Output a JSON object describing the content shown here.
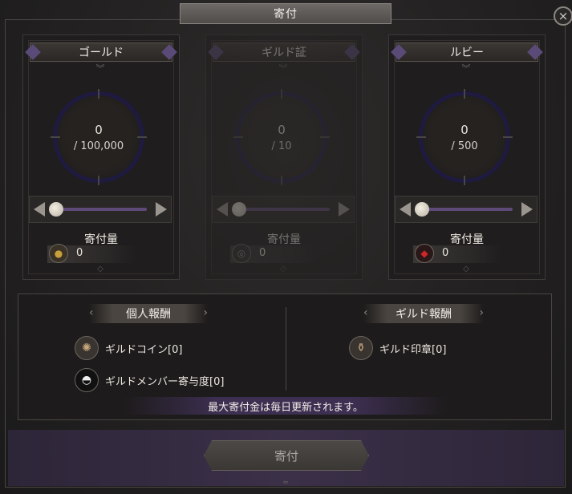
{
  "window": {
    "title": "寄付",
    "close_icon": "×"
  },
  "panels": [
    {
      "name": "ゴールド",
      "current": "0",
      "max": "/ 100,000",
      "amount_label": "寄付量",
      "amount": "0",
      "icon": "gold-coin-icon",
      "icon_glyph": "●",
      "icon_color": "#c9a13a",
      "enabled": true
    },
    {
      "name": "ギルド証",
      "current": "0",
      "max": "/ 10",
      "amount_label": "寄付量",
      "amount": "0",
      "icon": "guild-token-icon",
      "icon_glyph": "◎",
      "icon_color": "#9a958f",
      "enabled": false
    },
    {
      "name": "ルビー",
      "current": "0",
      "max": "/ 500",
      "amount_label": "寄付量",
      "amount": "0",
      "icon": "ruby-icon",
      "icon_glyph": "◆",
      "icon_color": "#d0262a",
      "enabled": true
    }
  ],
  "rewards": {
    "personal": {
      "title": "個人報酬",
      "items": [
        {
          "label": "ギルドコイン[0]",
          "icon": "guild-coin-icon"
        },
        {
          "label": "ギルドメンバー寄与度[0]",
          "icon": "helmet-icon"
        }
      ]
    },
    "guild": {
      "title": "ギルド報酬",
      "items": [
        {
          "label": "ギルド印章[0]",
          "icon": "guild-seal-icon"
        }
      ]
    },
    "notice": "最大寄付金は毎日更新されます。"
  },
  "action": {
    "donate_label": "寄付"
  }
}
